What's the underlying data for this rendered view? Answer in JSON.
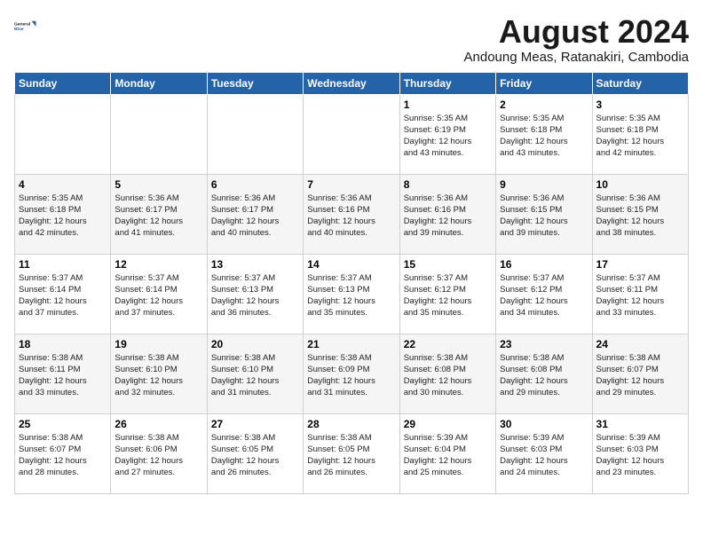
{
  "header": {
    "logo_line1": "General",
    "logo_line2": "Blue",
    "month_title": "August 2024",
    "subtitle": "Andoung Meas, Ratanakiri, Cambodia"
  },
  "days_of_week": [
    "Sunday",
    "Monday",
    "Tuesday",
    "Wednesday",
    "Thursday",
    "Friday",
    "Saturday"
  ],
  "weeks": [
    [
      {
        "day": "",
        "info": ""
      },
      {
        "day": "",
        "info": ""
      },
      {
        "day": "",
        "info": ""
      },
      {
        "day": "",
        "info": ""
      },
      {
        "day": "1",
        "info": "Sunrise: 5:35 AM\nSunset: 6:19 PM\nDaylight: 12 hours\nand 43 minutes."
      },
      {
        "day": "2",
        "info": "Sunrise: 5:35 AM\nSunset: 6:18 PM\nDaylight: 12 hours\nand 43 minutes."
      },
      {
        "day": "3",
        "info": "Sunrise: 5:35 AM\nSunset: 6:18 PM\nDaylight: 12 hours\nand 42 minutes."
      }
    ],
    [
      {
        "day": "4",
        "info": "Sunrise: 5:35 AM\nSunset: 6:18 PM\nDaylight: 12 hours\nand 42 minutes."
      },
      {
        "day": "5",
        "info": "Sunrise: 5:36 AM\nSunset: 6:17 PM\nDaylight: 12 hours\nand 41 minutes."
      },
      {
        "day": "6",
        "info": "Sunrise: 5:36 AM\nSunset: 6:17 PM\nDaylight: 12 hours\nand 40 minutes."
      },
      {
        "day": "7",
        "info": "Sunrise: 5:36 AM\nSunset: 6:16 PM\nDaylight: 12 hours\nand 40 minutes."
      },
      {
        "day": "8",
        "info": "Sunrise: 5:36 AM\nSunset: 6:16 PM\nDaylight: 12 hours\nand 39 minutes."
      },
      {
        "day": "9",
        "info": "Sunrise: 5:36 AM\nSunset: 6:15 PM\nDaylight: 12 hours\nand 39 minutes."
      },
      {
        "day": "10",
        "info": "Sunrise: 5:36 AM\nSunset: 6:15 PM\nDaylight: 12 hours\nand 38 minutes."
      }
    ],
    [
      {
        "day": "11",
        "info": "Sunrise: 5:37 AM\nSunset: 6:14 PM\nDaylight: 12 hours\nand 37 minutes."
      },
      {
        "day": "12",
        "info": "Sunrise: 5:37 AM\nSunset: 6:14 PM\nDaylight: 12 hours\nand 37 minutes."
      },
      {
        "day": "13",
        "info": "Sunrise: 5:37 AM\nSunset: 6:13 PM\nDaylight: 12 hours\nand 36 minutes."
      },
      {
        "day": "14",
        "info": "Sunrise: 5:37 AM\nSunset: 6:13 PM\nDaylight: 12 hours\nand 35 minutes."
      },
      {
        "day": "15",
        "info": "Sunrise: 5:37 AM\nSunset: 6:12 PM\nDaylight: 12 hours\nand 35 minutes."
      },
      {
        "day": "16",
        "info": "Sunrise: 5:37 AM\nSunset: 6:12 PM\nDaylight: 12 hours\nand 34 minutes."
      },
      {
        "day": "17",
        "info": "Sunrise: 5:37 AM\nSunset: 6:11 PM\nDaylight: 12 hours\nand 33 minutes."
      }
    ],
    [
      {
        "day": "18",
        "info": "Sunrise: 5:38 AM\nSunset: 6:11 PM\nDaylight: 12 hours\nand 33 minutes."
      },
      {
        "day": "19",
        "info": "Sunrise: 5:38 AM\nSunset: 6:10 PM\nDaylight: 12 hours\nand 32 minutes."
      },
      {
        "day": "20",
        "info": "Sunrise: 5:38 AM\nSunset: 6:10 PM\nDaylight: 12 hours\nand 31 minutes."
      },
      {
        "day": "21",
        "info": "Sunrise: 5:38 AM\nSunset: 6:09 PM\nDaylight: 12 hours\nand 31 minutes."
      },
      {
        "day": "22",
        "info": "Sunrise: 5:38 AM\nSunset: 6:08 PM\nDaylight: 12 hours\nand 30 minutes."
      },
      {
        "day": "23",
        "info": "Sunrise: 5:38 AM\nSunset: 6:08 PM\nDaylight: 12 hours\nand 29 minutes."
      },
      {
        "day": "24",
        "info": "Sunrise: 5:38 AM\nSunset: 6:07 PM\nDaylight: 12 hours\nand 29 minutes."
      }
    ],
    [
      {
        "day": "25",
        "info": "Sunrise: 5:38 AM\nSunset: 6:07 PM\nDaylight: 12 hours\nand 28 minutes."
      },
      {
        "day": "26",
        "info": "Sunrise: 5:38 AM\nSunset: 6:06 PM\nDaylight: 12 hours\nand 27 minutes."
      },
      {
        "day": "27",
        "info": "Sunrise: 5:38 AM\nSunset: 6:05 PM\nDaylight: 12 hours\nand 26 minutes."
      },
      {
        "day": "28",
        "info": "Sunrise: 5:38 AM\nSunset: 6:05 PM\nDaylight: 12 hours\nand 26 minutes."
      },
      {
        "day": "29",
        "info": "Sunrise: 5:39 AM\nSunset: 6:04 PM\nDaylight: 12 hours\nand 25 minutes."
      },
      {
        "day": "30",
        "info": "Sunrise: 5:39 AM\nSunset: 6:03 PM\nDaylight: 12 hours\nand 24 minutes."
      },
      {
        "day": "31",
        "info": "Sunrise: 5:39 AM\nSunset: 6:03 PM\nDaylight: 12 hours\nand 23 minutes."
      }
    ]
  ]
}
